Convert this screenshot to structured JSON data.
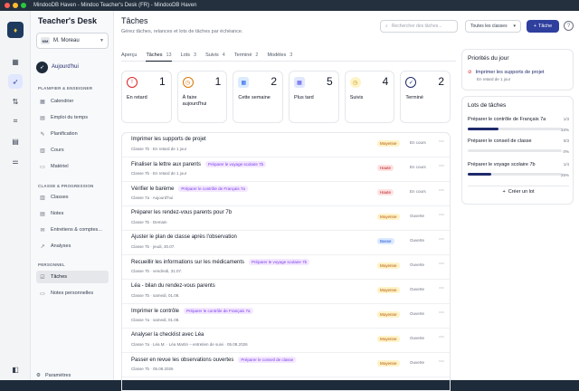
{
  "window": {
    "title": "MindooDB Haven - Mindoo Teacher's Desk (FR) - MindooDB Haven"
  },
  "sidebar": {
    "brand": "Teacher's Desk",
    "user": {
      "initials": "MM",
      "name": "M. Moreau"
    },
    "today": "Aujourd'hui",
    "sections": [
      {
        "title": "PLANIFIER & ENSEIGNER",
        "items": [
          "Calendrier",
          "Emploi du temps",
          "Planification",
          "Cours",
          "Matériel"
        ]
      },
      {
        "title": "CLASSE & PROGRESSION",
        "items": [
          "Classes",
          "Notes",
          "Entretiens & comptes...",
          "Analyses"
        ]
      },
      {
        "title": "PERSONNEL",
        "items": [
          "Tâches",
          "Notes personnelles"
        ]
      }
    ],
    "settings": "Paramètres"
  },
  "header": {
    "title": "Tâches",
    "subtitle": "Gérez tâches, relances et lots de tâches par échéance.",
    "search_placeholder": "Rechercher des tâches...",
    "class_filter": "Toutes les classes",
    "add_label": "Tâche"
  },
  "tabs": [
    {
      "label": "Aperçu",
      "count": ""
    },
    {
      "label": "Tâches",
      "count": "13"
    },
    {
      "label": "Lots",
      "count": "3"
    },
    {
      "label": "Suivis",
      "count": "4"
    },
    {
      "label": "Terminé",
      "count": "2"
    },
    {
      "label": "Modèles",
      "count": "3"
    }
  ],
  "summary": [
    {
      "label": "En retard",
      "value": "1",
      "color": "#dc2626"
    },
    {
      "label": "À faire aujourd'hui",
      "value": "1",
      "color": "#d97706"
    },
    {
      "label": "Cette semaine",
      "value": "2",
      "color": "#2563eb"
    },
    {
      "label": "Plus tard",
      "value": "5",
      "color": "#4f46e5"
    },
    {
      "label": "Suivis",
      "value": "4",
      "color": "#ca8a04"
    },
    {
      "label": "Terminé",
      "value": "2",
      "color": "#1f2a6b"
    }
  ],
  "tasks": [
    {
      "title": "Imprimer les supports de projet",
      "tag": "",
      "meta": "Classe 7b · En retard de 1 jour",
      "prio": "Moyenne",
      "status": "En cours"
    },
    {
      "title": "Finaliser la lettre aux parents",
      "tag": "Préparer le voyage scolaire 7b",
      "meta": "Classe 7b · En retard de 1 jour",
      "prio": "Haute",
      "status": "En cours"
    },
    {
      "title": "Vérifier le barème",
      "tag": "Préparer le contrôle de Français 7a",
      "meta": "Classe 7a · Aujourd'hui",
      "prio": "Haute",
      "status": "En cours"
    },
    {
      "title": "Préparer les rendez-vous parents pour 7b",
      "tag": "",
      "meta": "Classe 7b · Demain",
      "prio": "Moyenne",
      "status": "Ouverte"
    },
    {
      "title": "Ajuster le plan de classe après l'observation",
      "tag": "",
      "meta": "Classe 7b · jeudi, 30.07.",
      "prio": "Basse",
      "status": "Ouverte"
    },
    {
      "title": "Recueillir les informations sur les médicaments",
      "tag": "Préparer le voyage scolaire 7b",
      "meta": "Classe 7b · vendredi, 31.07.",
      "prio": "Moyenne",
      "status": "Ouverte"
    },
    {
      "title": "Léa - bilan du rendez-vous parents",
      "tag": "",
      "meta": "Classe 7b · samedi, 01.08.",
      "prio": "Moyenne",
      "status": "Ouverte"
    },
    {
      "title": "Imprimer le contrôle",
      "tag": "Préparer le contrôle de Français 7a",
      "meta": "Classe 7a · samedi, 01.08.",
      "prio": "Moyenne",
      "status": "Ouverte"
    },
    {
      "title": "Analyser la checklist avec Léa",
      "tag": "",
      "meta": "Classe 7a · Léa M. · Léa Martin – entretien de suivi · 05.08.2026",
      "prio": "Moyenne",
      "status": "Ouverte"
    },
    {
      "title": "Passer en revue les observations ouvertes",
      "tag": "Préparer le conseil de classe",
      "meta": "Classe 7b · 05.08.2026",
      "prio": "Moyenne",
      "status": "Ouverte"
    }
  ],
  "priorities": {
    "title": "Priorités du jour",
    "item": "Imprimer les supports de projet",
    "item_meta": "En retard de 1 jour"
  },
  "lots": {
    "title": "Lots de tâches",
    "items": [
      {
        "name": "Préparer le contrôle de Français 7a",
        "frac": "1/3",
        "pct": "33%",
        "progress": 0.33
      },
      {
        "name": "Préparer le conseil de classe",
        "frac": "0/3",
        "pct": "0%",
        "progress": 0
      },
      {
        "name": "Préparer le voyage scolaire 7b",
        "frac": "1/4",
        "pct": "25%",
        "progress": 0.25
      }
    ],
    "create": "Créer un lot"
  }
}
